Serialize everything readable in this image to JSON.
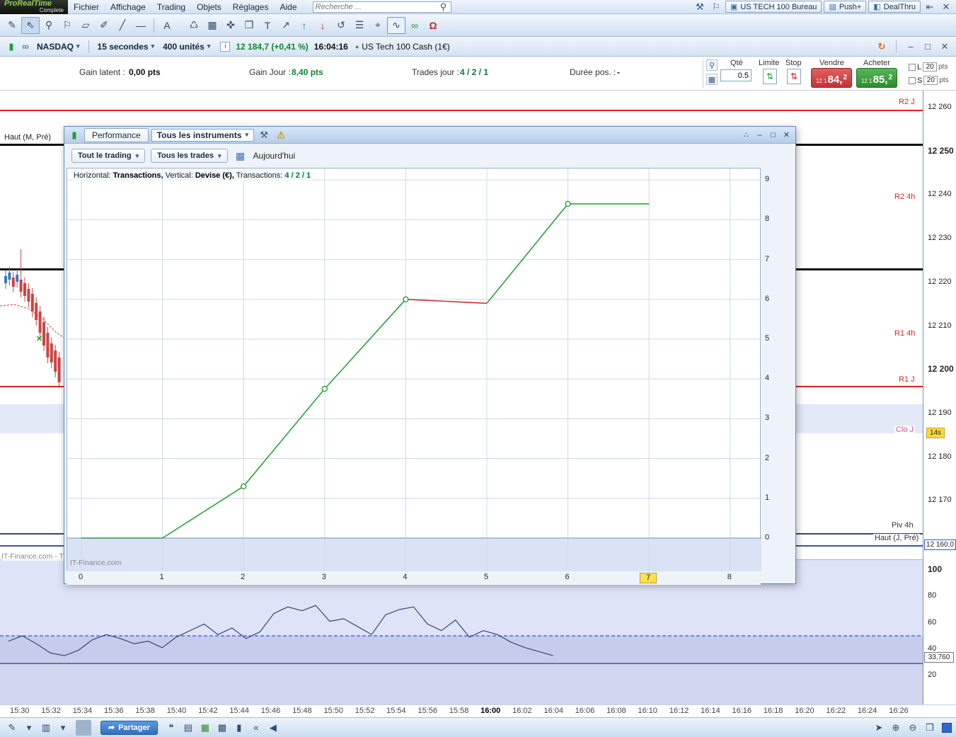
{
  "colors": {
    "accent_blue": "#3a6ea5",
    "sell_red": "#bf3434",
    "buy_green": "#2e8b2e",
    "gain_green": "#0b8a2f",
    "level_red": "#dd2222",
    "level_pink": "#e0529c",
    "highlight_yellow": "#ffe14d"
  },
  "icons": {
    "search": "⚲",
    "wand": "⚒",
    "bell": "⚐",
    "workspace": "▣",
    "push": "▤",
    "dealthru": "◧",
    "dock": "⇤",
    "close": "✕",
    "minimize": "–",
    "maximize": "□",
    "refresh": "↻",
    "candle_green": "▮",
    "link_small": "∞",
    "info": "i",
    "dot": "●",
    "doc_search": "⚲",
    "calculator": "▦",
    "spinner": "⇅",
    "share_node": "∴",
    "wrench": "⚒",
    "warning": "⚠",
    "calendar": "▦",
    "dropdown_arrow": "▾",
    "share_arrow": "➦"
  },
  "app": {
    "logo_title": "ProRealTime",
    "logo_subtitle": "Complete",
    "menus": [
      "Fichier",
      "Affichage",
      "Trading",
      "Objets",
      "Réglages",
      "Aide"
    ],
    "search_placeholder": "Recherche ...",
    "workspace_button": "US TECH 100 Bureau",
    "push_button": "Push+",
    "dealthru_button": "DealThru"
  },
  "draw_tools": [
    {
      "name": "pencil-icon",
      "glyph": "✎"
    },
    {
      "name": "pointer-icon",
      "glyph": "⇖"
    },
    {
      "name": "zoom-icon",
      "glyph": "⚲"
    },
    {
      "name": "alarm-icon",
      "glyph": "⚐"
    },
    {
      "name": "eraser-icon",
      "glyph": "▱"
    },
    {
      "name": "picker-icon",
      "glyph": "✐"
    },
    {
      "name": "trendline-icon",
      "glyph": "╱"
    },
    {
      "name": "segment-icon",
      "glyph": "—"
    },
    {
      "name": "separator",
      "glyph": ""
    },
    {
      "name": "fibonacci-icon",
      "glyph": "A"
    },
    {
      "name": "spacer",
      "glyph": ""
    },
    {
      "name": "trash-icon",
      "glyph": "♺"
    },
    {
      "name": "pattern-icon",
      "glyph": "▦"
    },
    {
      "name": "move-icon",
      "glyph": "✜"
    },
    {
      "name": "duplicate-icon",
      "glyph": "❐"
    },
    {
      "name": "text-icon",
      "glyph": "T"
    },
    {
      "name": "resize-icon",
      "glyph": "↗"
    },
    {
      "name": "arrow-up-icon",
      "glyph": "↑"
    },
    {
      "name": "arrow-down-icon",
      "glyph": "↓"
    },
    {
      "name": "lasso-icon",
      "glyph": "↺"
    },
    {
      "name": "watchlist-icon",
      "glyph": "☰"
    },
    {
      "name": "target-icon",
      "glyph": "⌖"
    },
    {
      "name": "chart-tools-icon",
      "glyph": "∿"
    },
    {
      "name": "link-icon",
      "glyph": "∞"
    },
    {
      "name": "magnet-icon",
      "glyph": "Ω"
    }
  ],
  "instrument_bar": {
    "market": "NASDAQ",
    "timeframe": "15 secondes",
    "units": "400 unités",
    "price": "12 184,7 (+0,41 %)",
    "time": "16:04:16",
    "instrument": "US Tech 100 Cash (1€)"
  },
  "stats_bar": {
    "gain_latent_label": "Gain latent :",
    "gain_latent": "0,00 pts",
    "gain_jour_label": "Gain Jour :",
    "gain_jour": "8,40 pts",
    "trades_label": "Trades jour :",
    "trades": "4 / 2 / 1",
    "duree_label": "Durée pos. :",
    "duree": "-"
  },
  "order_panel": {
    "qty_label": "Qté",
    "qty_value": "0.5",
    "limite_label": "Limite",
    "stop_label": "Stop",
    "sell_label": "Vendre",
    "sell_price_small": "12 1",
    "sell_price_big": "84,",
    "sell_price_sup": "2",
    "buy_label": "Acheter",
    "buy_price_small": "12 1",
    "buy_price_big": "85,",
    "buy_price_sup": "2",
    "l_label": "L",
    "l_value": "20",
    "l_unit": "pts",
    "s_label": "S",
    "s_value": "20",
    "s_unit": "pts"
  },
  "chart_levels": {
    "haut_m": "Haut (M, Pré)",
    "r2j": "R2 J",
    "r2_4h": "R2 4h",
    "r1_4h": "R1 4h",
    "r1j": "R1 J",
    "cloj": "Clo J",
    "piv4h": "Piv 4h",
    "hautj": "Haut (J, Pré)"
  },
  "price_axis": {
    "ticks": [
      "12 260",
      "12 250",
      "12 240",
      "12 230",
      "12 220",
      "12 210",
      "12 200",
      "12 190",
      "12 180",
      "12 170"
    ],
    "boxed_close": "12 160,0",
    "osc_ticks": [
      "100",
      "80",
      "60",
      "40",
      "20"
    ],
    "osc_value_box": "33,760",
    "timeframe_badge": "14s"
  },
  "watermarks": {
    "main": "IT-Finance.com - T",
    "perf": "IT-Finance.com"
  },
  "performance_window": {
    "tab": "Performance",
    "instruments_dropdown": "Tous les instruments",
    "filter_trading": "Tout le trading",
    "filter_trades": "Tous les trades",
    "date_filter": "Aujourd'hui",
    "info": {
      "h_label": "Horizontal:",
      "h_value": "Transactions,",
      "v_label": "Vertical:",
      "v_value": "Devise (€),",
      "t_label": "Transactions:",
      "t_value": "4 / 2 / 1"
    }
  },
  "time_axis": {
    "ticks": [
      "15:30",
      "15:32",
      "15:34",
      "15:36",
      "15:38",
      "15:40",
      "15:42",
      "15:44",
      "15:46",
      "15:48",
      "15:50",
      "15:52",
      "15:54",
      "15:56",
      "15:58",
      "16:00",
      "16:02",
      "16:04",
      "16:06",
      "16:08",
      "16:10",
      "16:12",
      "16:14",
      "16:16",
      "16:18",
      "16:20",
      "16:22",
      "16:24",
      "16:26"
    ],
    "bold_tick": "16:00"
  },
  "bottom_bar": {
    "share_label": "Partager"
  },
  "bottom_tools": [
    {
      "name": "draw-mode-icon",
      "glyph": "✎"
    },
    {
      "name": "chevron-down-icon",
      "glyph": "▾"
    },
    {
      "name": "chart-style-icon",
      "glyph": "▥"
    },
    {
      "name": "chevron-down-icon",
      "glyph": "▾"
    },
    {
      "name": "separator",
      "glyph": ""
    }
  ],
  "bottom_tools2": [
    {
      "name": "note-icon",
      "glyph": "❝"
    },
    {
      "name": "page-icon",
      "glyph": "▤"
    },
    {
      "name": "table-icon",
      "glyph": "▦"
    },
    {
      "name": "layout-icon",
      "glyph": "▩"
    },
    {
      "name": "candles-icon",
      "glyph": "▮"
    },
    {
      "name": "collapse-icon",
      "glyph": "«"
    },
    {
      "name": "back-icon",
      "glyph": "◀"
    }
  ],
  "bottom_tools_right": [
    {
      "name": "pan-icon",
      "glyph": "➤"
    },
    {
      "name": "zoom-in-icon",
      "glyph": "⊕"
    },
    {
      "name": "zoom-out-icon",
      "glyph": "⊖"
    },
    {
      "name": "fit-icon",
      "glyph": "❒"
    }
  ],
  "chart_data": [
    {
      "id": "performance-equity",
      "type": "line",
      "title": "Performance",
      "xlabel": "Transactions",
      "ylabel": "Devise (€)",
      "x_ticks": [
        0,
        1,
        2,
        3,
        4,
        5,
        6,
        7,
        8
      ],
      "y_ticks": [
        0,
        1,
        2,
        3,
        4,
        5,
        6,
        7,
        8,
        9
      ],
      "highlighted_x_tick": 7,
      "points": [
        [
          0,
          0
        ],
        [
          1,
          0
        ],
        [
          2,
          1.3
        ],
        [
          3,
          3.75
        ],
        [
          4,
          6.0
        ],
        [
          5,
          5.9
        ],
        [
          6,
          8.4
        ],
        [
          7,
          8.4
        ]
      ],
      "segment_colors": [
        "#2f9e3f",
        "#2f9e3f",
        "#2f9e3f",
        "#2f9e3f",
        "#cc3333",
        "#2f9e3f",
        "#2f9e3f"
      ],
      "markers": [
        [
          2,
          1.3
        ],
        [
          3,
          3.75
        ],
        [
          4,
          6.0
        ],
        [
          6,
          8.4
        ]
      ],
      "line_color": "#2f9e3f",
      "grid": true,
      "legend": "none"
    },
    {
      "id": "momentum-indicator",
      "type": "line",
      "x_start": "15:29",
      "x_end": "16:04",
      "y_ticks": [
        100,
        80,
        60,
        40,
        20
      ],
      "dashed_level": 50,
      "solid_level": 29,
      "right_label": "33,760",
      "values": [
        46,
        50,
        44,
        37,
        35,
        39,
        47,
        51,
        48,
        44,
        46,
        41,
        49,
        54,
        59,
        51,
        56,
        48,
        53,
        67,
        72,
        69,
        73,
        61,
        63,
        57,
        51,
        66,
        70,
        72,
        59,
        54,
        62,
        49,
        54,
        51,
        45,
        41,
        38,
        35
      ],
      "line_color": "#2a3a6e"
    }
  ]
}
